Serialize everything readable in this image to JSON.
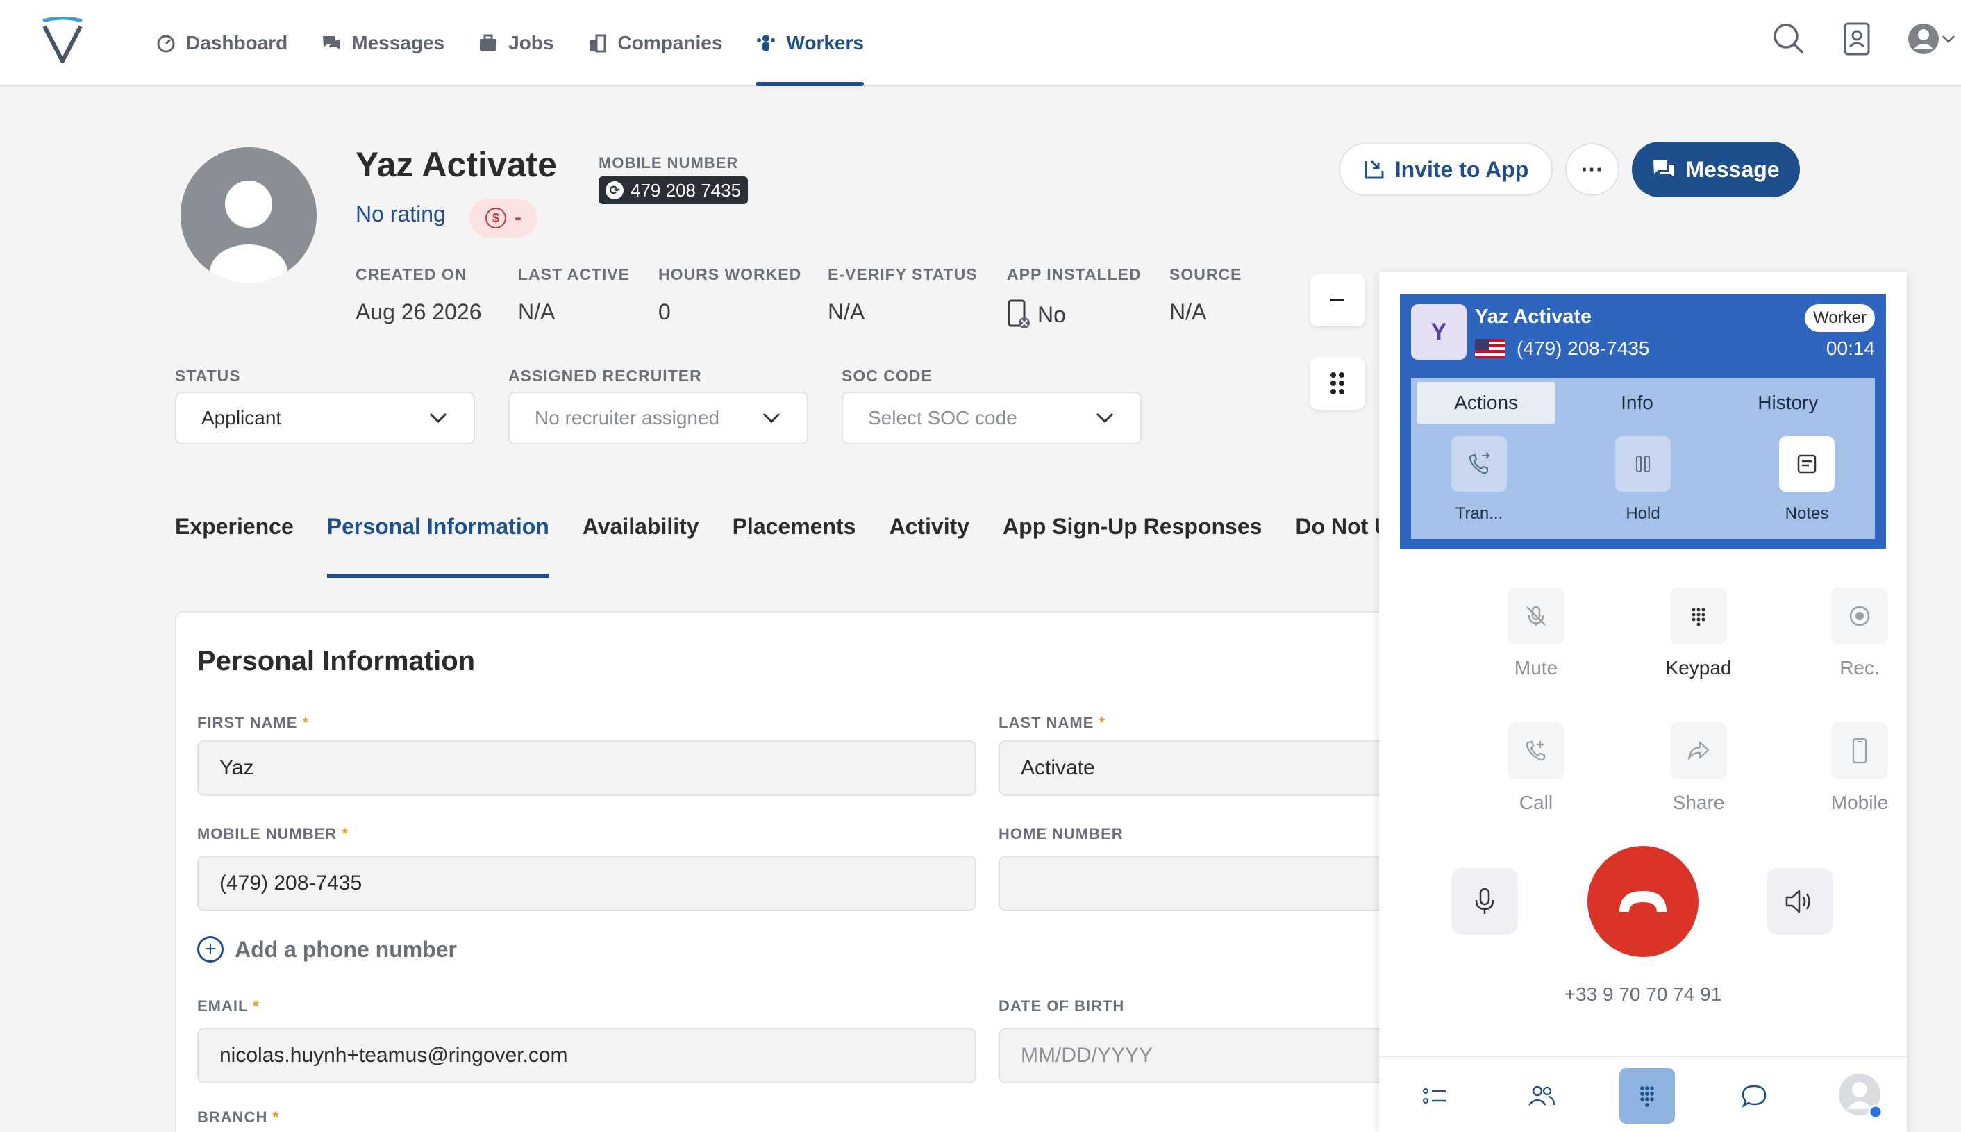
{
  "nav": {
    "items": [
      {
        "label": "Dashboard",
        "icon": "dashboard-icon"
      },
      {
        "label": "Messages",
        "icon": "messages-icon"
      },
      {
        "label": "Jobs",
        "icon": "briefcase-icon"
      },
      {
        "label": "Companies",
        "icon": "building-icon"
      },
      {
        "label": "Workers",
        "icon": "workers-icon",
        "active": true
      }
    ]
  },
  "profile": {
    "name": "Yaz Activate",
    "rating": "No rating",
    "pay_badge": "-",
    "mobile_label": "MOBILE NUMBER",
    "mobile_number": "479 208 7435",
    "stats": [
      {
        "label": "CREATED ON",
        "value": "Aug 26 2026"
      },
      {
        "label": "LAST ACTIVE",
        "value": "N/A"
      },
      {
        "label": "HOURS WORKED",
        "value": "0"
      },
      {
        "label": "E-VERIFY STATUS",
        "value": "N/A"
      },
      {
        "label": "APP INSTALLED",
        "value": "No"
      },
      {
        "label": "SOURCE",
        "value": "N/A"
      }
    ]
  },
  "actions": {
    "invite": "Invite to App",
    "more": "···",
    "message": "Message"
  },
  "selects": {
    "status_label": "STATUS",
    "status_value": "Applicant",
    "recruiter_label": "ASSIGNED RECRUITER",
    "recruiter_value": "No recruiter assigned",
    "soc_label": "SOC CODE",
    "soc_value": "Select SOC code"
  },
  "tabs": [
    "Experience",
    "Personal Information",
    "Availability",
    "Placements",
    "Activity",
    "App Sign-Up Responses",
    "Do Not Us"
  ],
  "personal": {
    "title": "Personal Information",
    "first_name_label": "FIRST NAME",
    "first_name": "Yaz",
    "last_name_label": "LAST NAME",
    "last_name": "Activate",
    "mobile_label": "MOBILE NUMBER",
    "mobile": "(479) 208-7435",
    "home_label": "HOME NUMBER",
    "home": "",
    "add_phone": "Add a phone number",
    "email_label": "EMAIL",
    "email": "nicolas.huynh+teamus@ringover.com",
    "dob_label": "DATE OF BIRTH",
    "dob_placeholder": "MM/DD/YYYY",
    "branch_label": "BRANCH",
    "required_mark": "*"
  },
  "phone": {
    "avatar_letter": "Y",
    "caller_name": "Yaz Activate",
    "caller_number": "(479) 208-7435",
    "badge": "Worker",
    "timer": "00:14",
    "tabs": [
      "Actions",
      "Info",
      "History"
    ],
    "actions": [
      {
        "label": "Tran...",
        "icon": "transfer-icon"
      },
      {
        "label": "Hold",
        "icon": "pause-icon"
      },
      {
        "label": "Notes",
        "icon": "notes-icon"
      }
    ],
    "controls": [
      {
        "label": "Mute",
        "icon": "mute-icon"
      },
      {
        "label": "Keypad",
        "icon": "keypad-icon"
      },
      {
        "label": "Rec.",
        "icon": "record-icon"
      },
      {
        "label": "Call",
        "icon": "add-call-icon"
      },
      {
        "label": "Share",
        "icon": "share-icon"
      },
      {
        "label": "Mobile",
        "icon": "mobile-icon"
      }
    ],
    "caller_id": "+33 9 70 70 74 91"
  },
  "colors": {
    "primary": "#1f4e8c",
    "call_blue": "#2e65bf",
    "hangup_red": "#d93427"
  }
}
